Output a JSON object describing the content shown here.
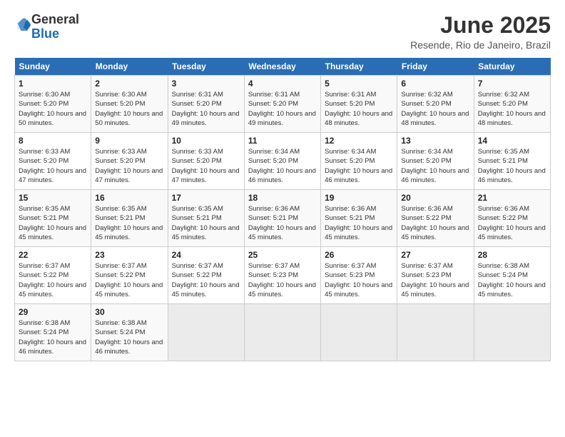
{
  "header": {
    "logo_general": "General",
    "logo_blue": "Blue",
    "month_title": "June 2025",
    "location": "Resende, Rio de Janeiro, Brazil"
  },
  "days_of_week": [
    "Sunday",
    "Monday",
    "Tuesday",
    "Wednesday",
    "Thursday",
    "Friday",
    "Saturday"
  ],
  "weeks": [
    [
      {
        "day": "1",
        "sunrise": "6:30 AM",
        "sunset": "5:20 PM",
        "daylight": "10 hours and 50 minutes."
      },
      {
        "day": "2",
        "sunrise": "6:30 AM",
        "sunset": "5:20 PM",
        "daylight": "10 hours and 50 minutes."
      },
      {
        "day": "3",
        "sunrise": "6:31 AM",
        "sunset": "5:20 PM",
        "daylight": "10 hours and 49 minutes."
      },
      {
        "day": "4",
        "sunrise": "6:31 AM",
        "sunset": "5:20 PM",
        "daylight": "10 hours and 49 minutes."
      },
      {
        "day": "5",
        "sunrise": "6:31 AM",
        "sunset": "5:20 PM",
        "daylight": "10 hours and 48 minutes."
      },
      {
        "day": "6",
        "sunrise": "6:32 AM",
        "sunset": "5:20 PM",
        "daylight": "10 hours and 48 minutes."
      },
      {
        "day": "7",
        "sunrise": "6:32 AM",
        "sunset": "5:20 PM",
        "daylight": "10 hours and 48 minutes."
      }
    ],
    [
      {
        "day": "8",
        "sunrise": "6:33 AM",
        "sunset": "5:20 PM",
        "daylight": "10 hours and 47 minutes."
      },
      {
        "day": "9",
        "sunrise": "6:33 AM",
        "sunset": "5:20 PM",
        "daylight": "10 hours and 47 minutes."
      },
      {
        "day": "10",
        "sunrise": "6:33 AM",
        "sunset": "5:20 PM",
        "daylight": "10 hours and 47 minutes."
      },
      {
        "day": "11",
        "sunrise": "6:34 AM",
        "sunset": "5:20 PM",
        "daylight": "10 hours and 46 minutes."
      },
      {
        "day": "12",
        "sunrise": "6:34 AM",
        "sunset": "5:20 PM",
        "daylight": "10 hours and 46 minutes."
      },
      {
        "day": "13",
        "sunrise": "6:34 AM",
        "sunset": "5:20 PM",
        "daylight": "10 hours and 46 minutes."
      },
      {
        "day": "14",
        "sunrise": "6:35 AM",
        "sunset": "5:21 PM",
        "daylight": "10 hours and 46 minutes."
      }
    ],
    [
      {
        "day": "15",
        "sunrise": "6:35 AM",
        "sunset": "5:21 PM",
        "daylight": "10 hours and 45 minutes."
      },
      {
        "day": "16",
        "sunrise": "6:35 AM",
        "sunset": "5:21 PM",
        "daylight": "10 hours and 45 minutes."
      },
      {
        "day": "17",
        "sunrise": "6:35 AM",
        "sunset": "5:21 PM",
        "daylight": "10 hours and 45 minutes."
      },
      {
        "day": "18",
        "sunrise": "6:36 AM",
        "sunset": "5:21 PM",
        "daylight": "10 hours and 45 minutes."
      },
      {
        "day": "19",
        "sunrise": "6:36 AM",
        "sunset": "5:21 PM",
        "daylight": "10 hours and 45 minutes."
      },
      {
        "day": "20",
        "sunrise": "6:36 AM",
        "sunset": "5:22 PM",
        "daylight": "10 hours and 45 minutes."
      },
      {
        "day": "21",
        "sunrise": "6:36 AM",
        "sunset": "5:22 PM",
        "daylight": "10 hours and 45 minutes."
      }
    ],
    [
      {
        "day": "22",
        "sunrise": "6:37 AM",
        "sunset": "5:22 PM",
        "daylight": "10 hours and 45 minutes."
      },
      {
        "day": "23",
        "sunrise": "6:37 AM",
        "sunset": "5:22 PM",
        "daylight": "10 hours and 45 minutes."
      },
      {
        "day": "24",
        "sunrise": "6:37 AM",
        "sunset": "5:22 PM",
        "daylight": "10 hours and 45 minutes."
      },
      {
        "day": "25",
        "sunrise": "6:37 AM",
        "sunset": "5:23 PM",
        "daylight": "10 hours and 45 minutes."
      },
      {
        "day": "26",
        "sunrise": "6:37 AM",
        "sunset": "5:23 PM",
        "daylight": "10 hours and 45 minutes."
      },
      {
        "day": "27",
        "sunrise": "6:37 AM",
        "sunset": "5:23 PM",
        "daylight": "10 hours and 45 minutes."
      },
      {
        "day": "28",
        "sunrise": "6:38 AM",
        "sunset": "5:24 PM",
        "daylight": "10 hours and 45 minutes."
      }
    ],
    [
      {
        "day": "29",
        "sunrise": "6:38 AM",
        "sunset": "5:24 PM",
        "daylight": "10 hours and 46 minutes."
      },
      {
        "day": "30",
        "sunrise": "6:38 AM",
        "sunset": "5:24 PM",
        "daylight": "10 hours and 46 minutes."
      },
      null,
      null,
      null,
      null,
      null
    ]
  ]
}
